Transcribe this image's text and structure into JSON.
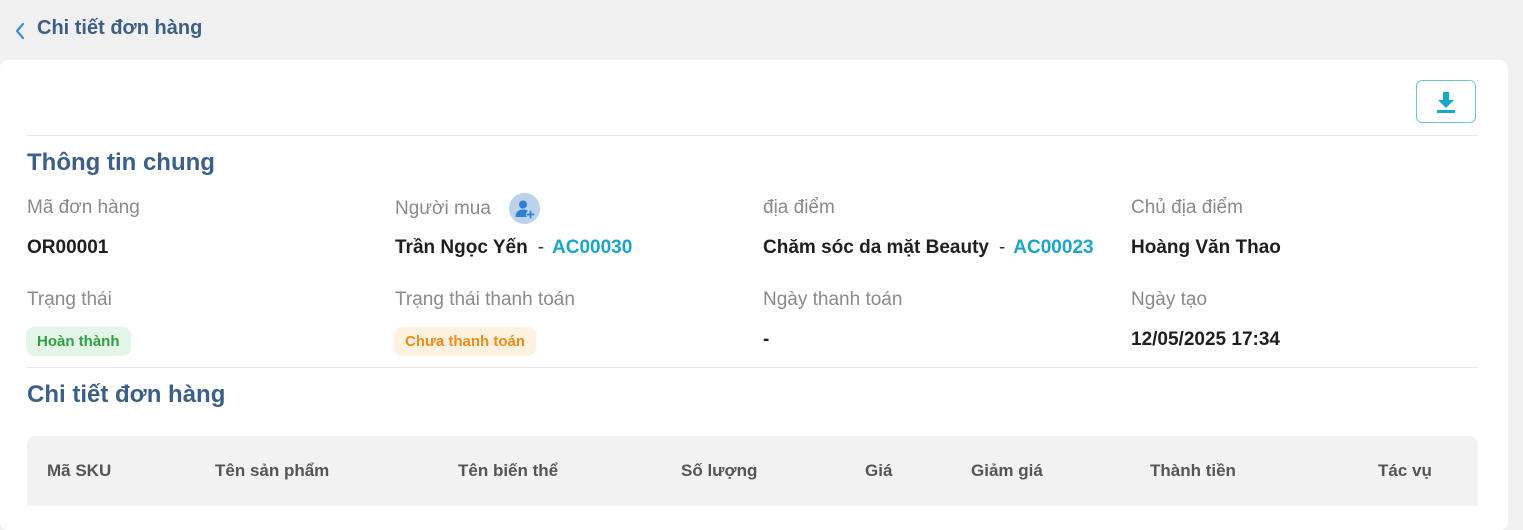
{
  "header": {
    "title": "Chi tiết đơn hàng"
  },
  "general": {
    "title": "Thông tin chung",
    "order_code_label": "Mã đơn hàng",
    "order_code": "OR00001",
    "buyer_label": "Người mua",
    "buyer_name": "Trần Ngọc Yến",
    "buyer_code": "AC00030",
    "location_label": "địa điểm",
    "location_name": "Chăm sóc da mặt Beauty",
    "location_code": "AC00023",
    "owner_label": "Chủ địa điểm",
    "owner_name": "Hoàng Văn Thao",
    "status_label": "Trạng thái",
    "status": "Hoàn thành",
    "payment_status_label": "Trạng thái thanh toán",
    "payment_status": "Chưa thanh toán",
    "payment_date_label": "Ngày thanh toán",
    "payment_date": "-",
    "created_label": "Ngày tạo",
    "created": "12/05/2025 17:34",
    "separator": "-"
  },
  "details": {
    "title": "Chi tiết đơn hàng",
    "columns": [
      "Mã SKU",
      "Tên sản phẩm",
      "Tên biến thể",
      "Số lượng",
      "Giá",
      "Giảm giá",
      "Thành tiền",
      "Tác vụ"
    ]
  },
  "icons": {
    "back": "chevron-left-icon",
    "download": "download-icon",
    "buyer": "user-add-icon"
  },
  "colors": {
    "title": "#3b5f87",
    "link": "#1aa6c8",
    "status_done_bg": "#e3f5e6",
    "status_done_text": "#2fa045",
    "status_unpaid_bg": "#fdf1e0",
    "status_unpaid_text": "#f08c1a"
  }
}
